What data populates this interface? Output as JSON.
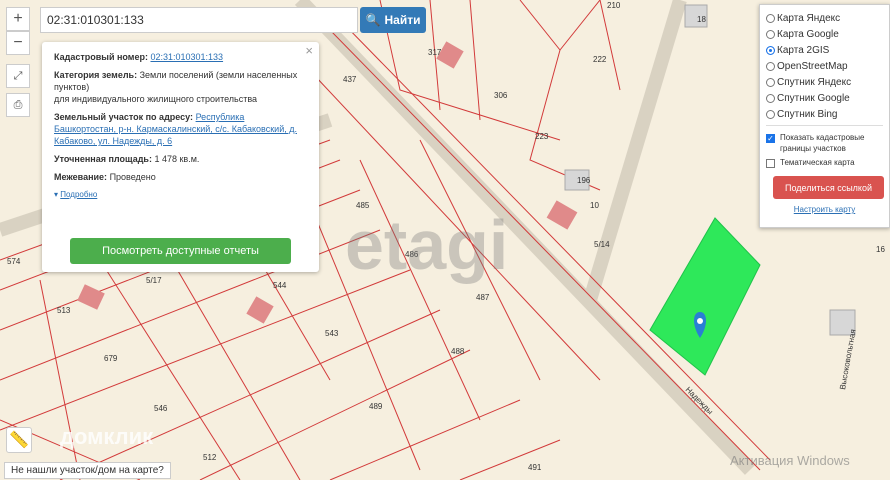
{
  "search": {
    "value": "02:31:010301:133",
    "button": "Найти"
  },
  "controls": {
    "zoom_in": "+",
    "zoom_out": "−"
  },
  "popup": {
    "cad_label": "Кадастровый номер:",
    "cad_value": "02:31:010301:133",
    "cat_label": "Категория земель:",
    "cat_value": "Земли поселений (земли населенных пунктов)",
    "cat_use": "для индивидуального жилищного строительства",
    "addr_label": "Земельный участок по адресу:",
    "addr_value": "Республика Башкортостан, р-н. Кармаскалинский, с/с. Кабаковский, д. Кабаково, ул. Надежды, д. 6",
    "area_label": "Уточненная площадь:",
    "area_value": "1 478 кв.м.",
    "survey_label": "Межевание:",
    "survey_value": "Проведено",
    "more": "Подробно",
    "reports_button": "Посмотреть доступные отчеты",
    "close": "×"
  },
  "layers": {
    "options": [
      "Карта Яндекс",
      "Карта Google",
      "Карта 2GIS",
      "OpenStreetMap",
      "Спутник Яндекс",
      "Спутник Google",
      "Спутник Bing"
    ],
    "selected": "Карта 2GIS",
    "show_borders": "Показать кадастровые границы участков",
    "thematic": "Тематическая карта",
    "share": "Поделиться ссылкой",
    "configure": "Настроить карту"
  },
  "map": {
    "parcels": [
      "18",
      "210",
      "317",
      "222",
      "306",
      "437",
      "223",
      "196",
      "10",
      "5/14",
      "16",
      "485",
      "574",
      "486",
      "5/17",
      "544",
      "487",
      "513",
      "543",
      "679",
      "488",
      "546",
      "489",
      "512",
      "491"
    ],
    "streets": [
      "Надежды",
      "Высоковольтная"
    ],
    "parcel_color": "#d23a3a",
    "highlight_color": "#2ee85a"
  },
  "watermarks": {
    "etagi": "etagi",
    "domclick": "домклик",
    "windows": "Активация Windows"
  },
  "bottom_link": "Не нашли участок/дом на карте?"
}
